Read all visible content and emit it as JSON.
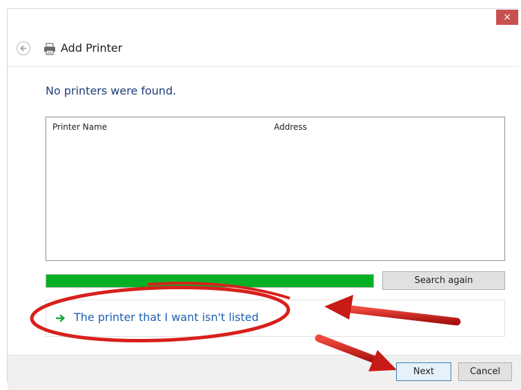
{
  "window": {
    "close_glyph": "×",
    "title": "Add Printer"
  },
  "icons": {
    "back": "back-arrow-icon",
    "printer": "printer-icon",
    "option_arrow": "green-arrow-icon",
    "close": "close-icon"
  },
  "main": {
    "heading": "No printers were found.",
    "list_columns": [
      "Printer Name",
      "Address"
    ],
    "search_progress": 1.0,
    "search_again_label": "Search again",
    "not_listed_option": "The printer that I want isn't listed"
  },
  "footer": {
    "next_label": "Next",
    "cancel_label": "Cancel"
  },
  "colors": {
    "close_button": "#c75050",
    "progress_fill": "#06b025",
    "heading": "#1f3d7a",
    "link": "#1b5fb3",
    "annotation_red": "#d8201c"
  }
}
